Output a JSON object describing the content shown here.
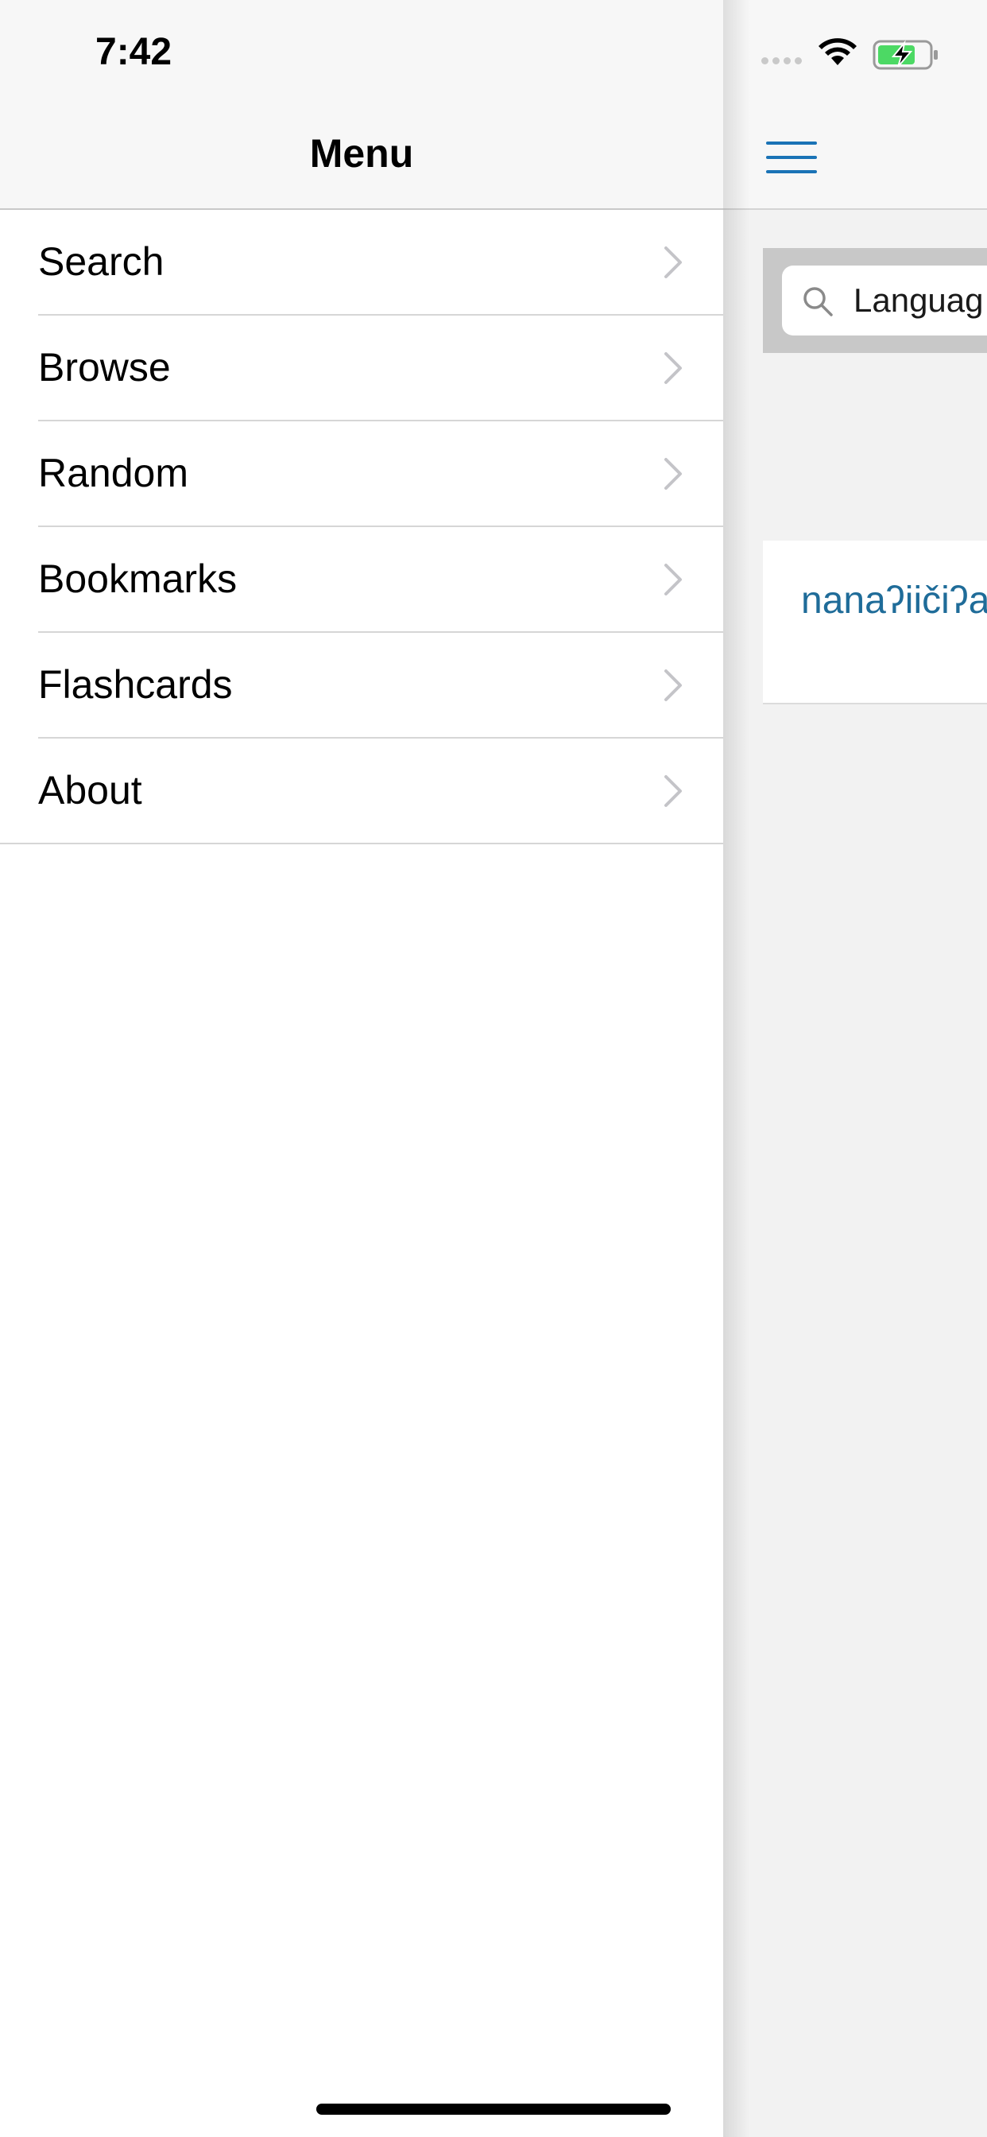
{
  "status_bar": {
    "time": "7:42"
  },
  "drawer": {
    "title": "Menu",
    "items": [
      {
        "label": "Search",
        "icon": "chevron-right-icon"
      },
      {
        "label": "Browse",
        "icon": "chevron-right-icon"
      },
      {
        "label": "Random",
        "icon": "chevron-right-icon"
      },
      {
        "label": "Bookmarks",
        "icon": "chevron-right-icon"
      },
      {
        "label": "Flashcards",
        "icon": "chevron-right-icon"
      },
      {
        "label": "About",
        "icon": "chevron-right-icon"
      }
    ]
  },
  "main": {
    "menu_icon": "hamburger-menu-icon",
    "search": {
      "icon": "search-icon",
      "placeholder": "Languag"
    },
    "result": {
      "title": "nanaʔiičiʔa"
    }
  },
  "colors": {
    "accent": "#1a73b6",
    "link": "#1f6c99",
    "battery": "#4cd964"
  }
}
